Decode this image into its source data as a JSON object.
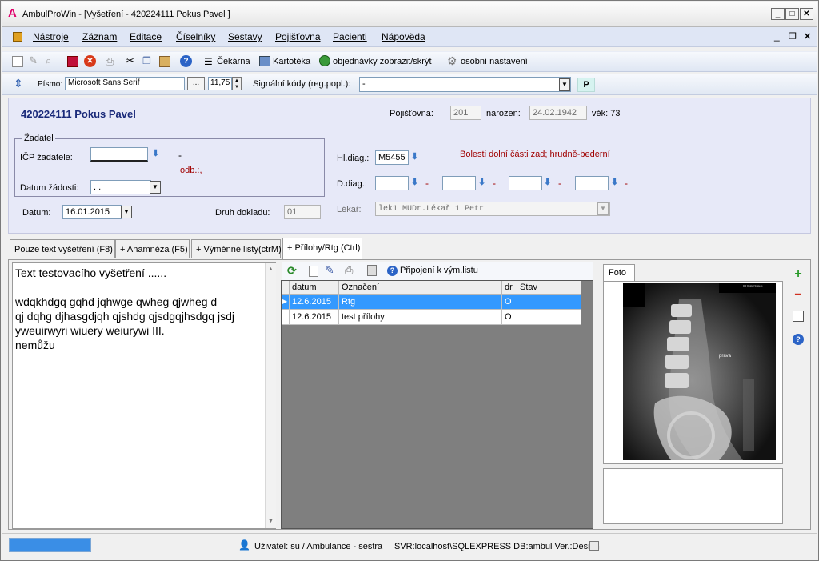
{
  "window": {
    "app_name": "AmbulProWin",
    "title": "AmbulProWin  - [Vyšetření - 420224111 Pokus Pavel ]",
    "min": "_",
    "max": "□",
    "close": "✕"
  },
  "menu": [
    "Nástroje",
    "Záznam",
    "Editace",
    "Číselníky",
    "Sestavy",
    "Pojišťovna",
    "Pacienti",
    "Nápověda"
  ],
  "toolbar": {
    "cekarna": "Čekárna",
    "kartoteka": "Kartotéka",
    "objednavky": "objednávky zobrazit/skrýt",
    "nastaveni": "osobní nastavení"
  },
  "fontbar": {
    "font_label": "Písmo:",
    "font_value": "Microsoft Sans Serif",
    "ellipsis": "...",
    "size_value": "11,75",
    "signal_label": "Signální  kódy (reg.popl.):",
    "signal_value": "-",
    "p_button": "P"
  },
  "patient": {
    "name": "420224111 Pokus Pavel",
    "insurance_label": "Pojišťovna:",
    "insurance_value": "201",
    "born_label": "narozen:",
    "born_value": "24.02.1942",
    "age_label": "věk: 73"
  },
  "zadatel": {
    "group_title": "Žadatel",
    "icp_label": "IČP žadatele:",
    "icp_dash": "-",
    "odb": "odb.:,",
    "date_label": "Datum žádosti:",
    "date_value": ". ."
  },
  "exam": {
    "date_label": "Datum:",
    "date_value": "16.01.2015",
    "doc_type_label": "Druh dokladu:",
    "doc_type_value": "01",
    "hl_diag_label": "Hl.diag.:",
    "hl_diag_value": "M5455",
    "hl_diag_text": "Bolesti dolní části zad; hrudně-bederní",
    "d_diag_label": "D.diag.:",
    "lekar_label": "Lékař:",
    "lekar_value": "lek1     MUDr.Lékař 1 Petr"
  },
  "tabs": [
    {
      "label": "Pouze text vyšetření (F8)"
    },
    {
      "label": "+ Anamnéza (F5)"
    },
    {
      "label": "+ Výměnné listy(ctrM)"
    },
    {
      "label": "+ Přílohy/Rtg (Ctrl)"
    }
  ],
  "exam_text": {
    "line1": "Text testovacího vyšetření ......",
    "line2": "wdqkhdgq gqhd jqhwge qwheg qjwheg d",
    "line3": "qj dqhg djhasgdjqh qjshdg qjsdgqjhsdgq jsdj",
    "line4": "yweuirwyri wiuery weiurywi  III.",
    "line5": "nemůžu"
  },
  "attachments": {
    "connect_label": "Připojení k vým.listu",
    "columns": [
      "datum",
      "Označení",
      "dr",
      "Stav"
    ],
    "rows": [
      {
        "datum": "12.6.2015",
        "oznaceni": "Rtg",
        "dr": "O",
        "stav": ""
      },
      {
        "datum": "12.6.2015",
        "oznaceni": "test přílohy",
        "dr": "O",
        "stav": ""
      }
    ]
  },
  "photo": {
    "tab_label": "Foto",
    "xray_label": "prava",
    "xray_brand": "DR Digital System"
  },
  "status": {
    "user": "Uživatel: su / Ambulance - sestra",
    "server": "SVR:localhost\\SQLEXPRESS DB:ambul Ver.:Design"
  },
  "colors": {
    "accent": "#3a8ee6",
    "form_bg": "#e7e9f8",
    "patient_name": "#1a2a7a",
    "diag_text": "#a00000"
  }
}
